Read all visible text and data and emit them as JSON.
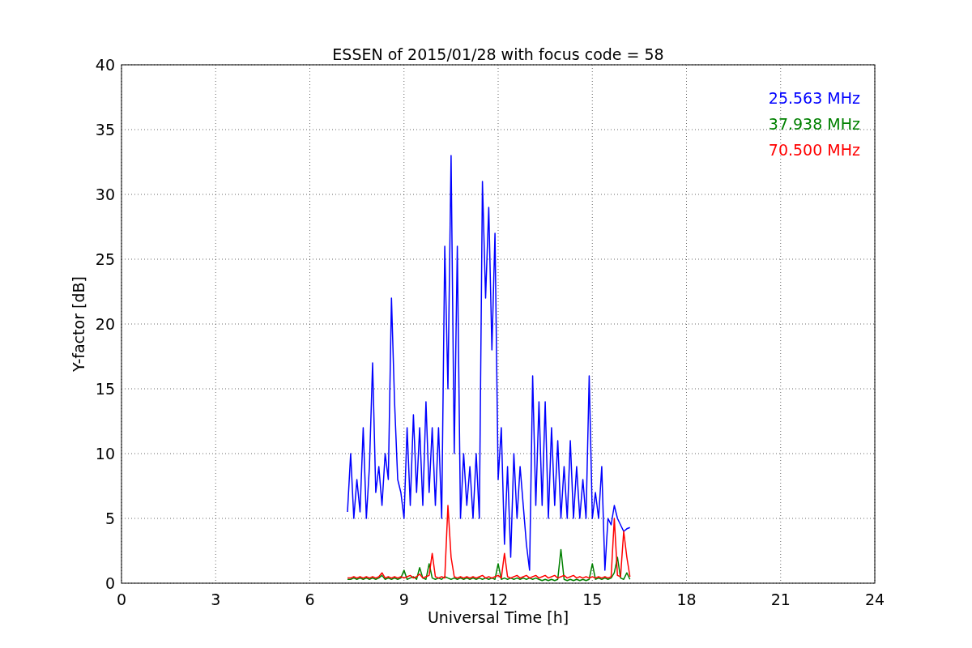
{
  "figure": {
    "chart_data": {
      "type": "line",
      "title": "ESSEN of 2015/01/28 with focus code = 58",
      "xlabel": "Universal Time [h]",
      "ylabel": "Y-factor [dB]",
      "xlim": [
        0,
        24
      ],
      "ylim": [
        0,
        40
      ],
      "grid": true,
      "xticks": [
        0,
        3,
        6,
        9,
        12,
        15,
        18,
        21,
        24
      ],
      "yticks": [
        0,
        5,
        10,
        15,
        20,
        25,
        30,
        35,
        40
      ],
      "x": [
        7.2,
        7.3,
        7.4,
        7.5,
        7.6,
        7.7,
        7.8,
        7.9,
        8.0,
        8.1,
        8.2,
        8.3,
        8.4,
        8.5,
        8.6,
        8.7,
        8.8,
        8.9,
        9.0,
        9.1,
        9.2,
        9.3,
        9.4,
        9.5,
        9.6,
        9.7,
        9.8,
        9.9,
        10.0,
        10.1,
        10.2,
        10.3,
        10.4,
        10.5,
        10.6,
        10.7,
        10.8,
        10.9,
        11.0,
        11.1,
        11.2,
        11.3,
        11.4,
        11.5,
        11.6,
        11.7,
        11.8,
        11.9,
        12.0,
        12.1,
        12.2,
        12.3,
        12.4,
        12.5,
        12.6,
        12.7,
        12.8,
        12.9,
        13.0,
        13.1,
        13.2,
        13.3,
        13.4,
        13.5,
        13.6,
        13.7,
        13.8,
        13.9,
        14.0,
        14.1,
        14.2,
        14.3,
        14.4,
        14.5,
        14.6,
        14.7,
        14.8,
        14.9,
        15.0,
        15.1,
        15.2,
        15.3,
        15.4,
        15.5,
        15.6,
        15.7,
        15.8,
        15.9,
        16.0,
        16.1,
        16.2
      ],
      "series": [
        {
          "name": "25.563 MHz",
          "color": "#0000ff",
          "values": [
            5.5,
            10,
            5,
            8,
            5.5,
            12,
            5,
            9,
            17,
            7,
            9,
            6,
            10,
            8,
            22,
            14,
            8,
            7,
            5,
            12,
            6,
            13,
            7,
            12,
            6,
            14,
            7,
            12,
            6,
            12,
            5,
            26,
            15,
            33,
            10,
            26,
            5,
            10,
            6,
            9,
            5,
            10,
            5,
            31,
            22,
            29,
            18,
            27,
            8,
            12,
            3,
            9,
            2,
            10,
            5,
            9,
            6,
            3,
            1,
            16,
            6,
            14,
            6,
            14,
            5,
            12,
            6,
            11,
            5,
            9,
            5,
            11,
            5,
            9,
            5,
            8,
            5,
            16,
            5,
            7,
            5,
            9,
            1,
            5,
            4.5,
            6,
            5,
            4.5,
            4,
            4.2,
            4.3
          ]
        },
        {
          "name": "37.938 MHz",
          "color": "#008000",
          "values": [
            0.3,
            0.3,
            0.4,
            0.3,
            0.4,
            0.3,
            0.4,
            0.3,
            0.4,
            0.3,
            0.4,
            0.6,
            0.3,
            0.4,
            0.3,
            0.4,
            0.3,
            0.4,
            1,
            0.3,
            0.4,
            0.5,
            0.3,
            1.2,
            0.4,
            0.3,
            1.5,
            0.4,
            0.3,
            0.4,
            0.3,
            0.5,
            0.4,
            0.3,
            0.4,
            0.3,
            0.4,
            0.3,
            0.4,
            0.3,
            0.4,
            0.3,
            0.4,
            0.3,
            0.4,
            0.3,
            0.4,
            0.3,
            1.5,
            0.3,
            0.4,
            0.3,
            0.4,
            0.3,
            0.4,
            0.3,
            0.4,
            0.3,
            0.4,
            0.3,
            0.4,
            0.3,
            0.2,
            0.3,
            0.2,
            0.3,
            0.2,
            0.3,
            2.6,
            0.3,
            0.2,
            0.3,
            0.2,
            0.3,
            0.2,
            0.3,
            0.2,
            0.3,
            1.5,
            0.3,
            0.4,
            0.3,
            0.4,
            0.3,
            0.4,
            0.8,
            2,
            0.4,
            0.3,
            0.8,
            0.3
          ]
        },
        {
          "name": "70.500 MHz",
          "color": "#ff0000",
          "values": [
            0.4,
            0.4,
            0.5,
            0.4,
            0.5,
            0.4,
            0.5,
            0.4,
            0.5,
            0.4,
            0.5,
            0.8,
            0.4,
            0.5,
            0.4,
            0.5,
            0.4,
            0.5,
            0.4,
            0.5,
            0.6,
            0.4,
            0.5,
            0.7,
            0.4,
            0.5,
            0.6,
            2.3,
            0.5,
            0.4,
            0.5,
            0.4,
            6,
            2,
            0.5,
            0.4,
            0.5,
            0.4,
            0.5,
            0.4,
            0.5,
            0.4,
            0.5,
            0.6,
            0.4,
            0.5,
            0.4,
            0.5,
            0.6,
            0.4,
            2.3,
            0.5,
            0.4,
            0.5,
            0.6,
            0.4,
            0.5,
            0.6,
            0.4,
            0.5,
            0.6,
            0.4,
            0.5,
            0.6,
            0.4,
            0.5,
            0.6,
            0.4,
            0.5,
            0.6,
            0.4,
            0.5,
            0.6,
            0.4,
            0.5,
            0.4,
            0.5,
            0.4,
            0.5,
            0.4,
            0.5,
            0.4,
            0.5,
            0.4,
            0.5,
            5,
            0.6,
            0.5,
            4,
            2,
            0.5
          ]
        }
      ]
    }
  }
}
